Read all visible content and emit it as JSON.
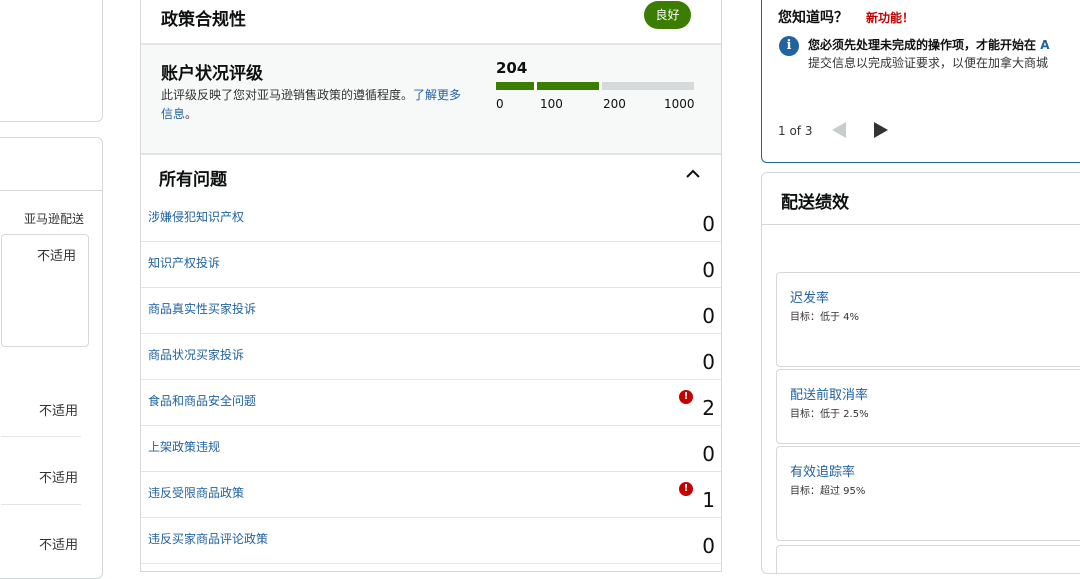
{
  "left": {
    "column_header": "亚马逊配送",
    "values": [
      "不适用",
      "不适用",
      "不适用",
      "不适用"
    ]
  },
  "policy": {
    "title": "政策合规性",
    "badge": "良好",
    "rating": {
      "title": "账户状况评级",
      "description": "此评级反映了您对亚马逊销售政策的遵循程度。",
      "link": "了解更多信息",
      "period": "。",
      "score": "204",
      "ticks": [
        "0",
        "100",
        "200",
        "1000"
      ],
      "score_fraction": 0.204,
      "colors": {
        "good": "#3a7d00",
        "empty": "#d5d9d9"
      }
    },
    "issues_title": "所有问题",
    "issues": [
      {
        "label": "涉嫌侵犯知识产权",
        "count": "0",
        "alert": false
      },
      {
        "label": "知识产权投诉",
        "count": "0",
        "alert": false
      },
      {
        "label": "商品真实性买家投诉",
        "count": "0",
        "alert": false
      },
      {
        "label": "商品状况买家投诉",
        "count": "0",
        "alert": false
      },
      {
        "label": "食品和商品安全问题",
        "count": "2",
        "alert": true
      },
      {
        "label": "上架政策违规",
        "count": "0",
        "alert": false
      },
      {
        "label": "违反受限商品政策",
        "count": "1",
        "alert": true
      },
      {
        "label": "违反买家商品评论政策",
        "count": "0",
        "alert": false
      }
    ]
  },
  "tip": {
    "question": "您知道吗？",
    "new_label": "新功能！",
    "line1": "您必须先处理未完成的操作项，才能开始在",
    "line1_link": "A",
    "line2": "提交信息以完成验证要求，以便在加拿大商城",
    "pager": "1 of 3",
    "accent": "#2162a1"
  },
  "shipping": {
    "title": "配送绩效",
    "metrics": [
      {
        "name": "迟发率",
        "target": "目标：低于 4%"
      },
      {
        "name": "配送前取消率",
        "target": "目标：低于 2.5%"
      },
      {
        "name": "有效追踪率",
        "target": "目标：超过 95%"
      }
    ]
  }
}
